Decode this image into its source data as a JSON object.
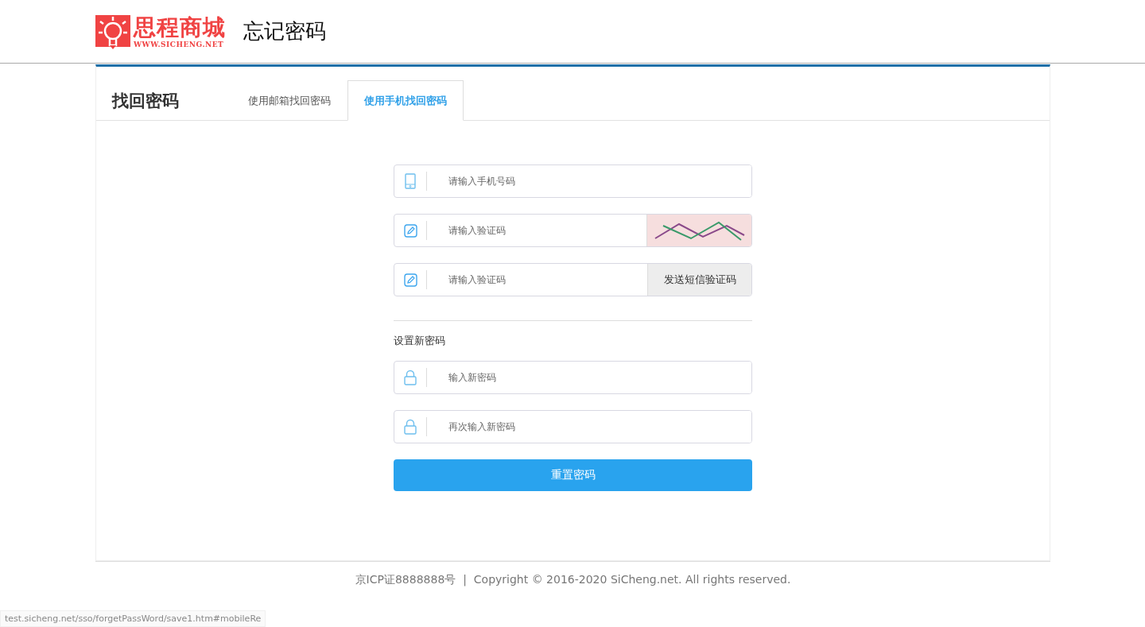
{
  "header": {
    "logo_name": "思程商城",
    "logo_url": "WWW.SICHENG.NET",
    "page_title": "忘记密码"
  },
  "panel": {
    "title": "找回密码",
    "tabs": [
      {
        "label": "使用邮箱找回密码",
        "selected": false
      },
      {
        "label": "使用手机找回密码",
        "selected": true
      }
    ]
  },
  "fields": [
    {
      "kind": "phone",
      "placeholder": "请输入手机号码"
    },
    {
      "kind": "captcha",
      "placeholder": "请输入验证码"
    },
    {
      "kind": "sms",
      "placeholder": "请输入验证码",
      "button": "发送短信验证码"
    }
  ],
  "new_password": {
    "label": "设置新密码",
    "fields": [
      {
        "kind": "password",
        "placeholder": "输入新密码"
      },
      {
        "kind": "password",
        "placeholder": "再次输入新密码"
      }
    ]
  },
  "submit": "重置密码",
  "footer": "京ICP证8888888号  |  Copyright © 2016-2020 SiCheng.net. All rights reserved.",
  "status_bar": "test.sicheng.net/sso/forgetPassWord/save1.htm#mobileRe"
}
